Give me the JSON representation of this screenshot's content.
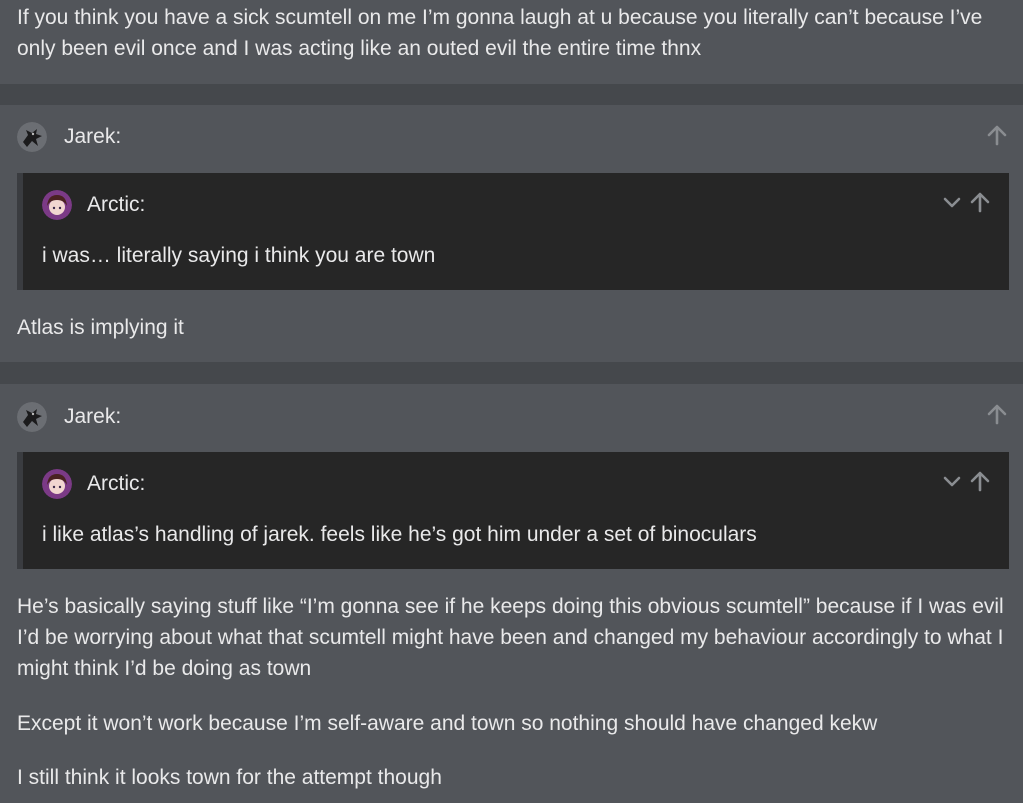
{
  "post1": {
    "body": "If you think you have a sick scumtell on me I’m gonna laugh at u because you literally can’t because I’ve only been evil once and I was acting like an outed evil the entire time thnx"
  },
  "post2": {
    "author": "Jarek:",
    "avatar_icon": "crow-avatar",
    "quote": {
      "author": "Arctic:",
      "avatar_icon": "anime-avatar",
      "text": "i was… literally saying i think you are town"
    },
    "reply": "Atlas is implying it"
  },
  "post3": {
    "author": "Jarek:",
    "avatar_icon": "crow-avatar",
    "quote": {
      "author": "Arctic:",
      "avatar_icon": "anime-avatar",
      "text": "i like atlas’s handling of jarek. feels like he’s got him under a set of binoculars"
    },
    "paragraphs": [
      "He’s basically saying stuff like “I’m gonna see if he keeps doing this obvious scumtell” because if I was evil I’d be worrying about what that scumtell might have been and changed my behaviour accordingly to what I might think I’d be doing as town",
      "Except it won’t work because I’m self-aware and town so nothing should have changed kekw",
      "I still think it looks town for the attempt though"
    ]
  },
  "colors": {
    "post_bg": "#52555a",
    "gap_bg": "#45484c",
    "quote_bg": "#262626",
    "text": "#e9e9ea",
    "icon": "#8a8d91"
  }
}
